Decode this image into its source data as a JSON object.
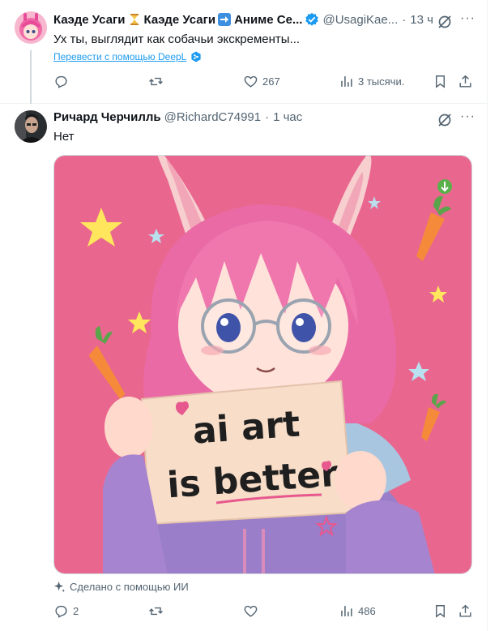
{
  "tweet1": {
    "display_name_part1": "Каэде Усаги",
    "display_name_part2": "Каэде Усаги",
    "display_name_part3": "Аниме Се...",
    "handle": "@UsagiKae...",
    "time": "13 ч",
    "text": "Ух ты, выглядит как собачьи экскременты...",
    "translate_link": "Перевести с помощью DeepL",
    "actions": {
      "reply": "",
      "retweet": "",
      "like": "267",
      "views": "3 тысячи."
    },
    "icons": {
      "emoji1": "hourglass-icon",
      "emoji2": "right-arrow-icon",
      "verified": "verified-badge-icon"
    }
  },
  "tweet2": {
    "display_name": "Ричард Черчилль",
    "handle": "@RichardC74991",
    "time": "1 час",
    "text": "Нет",
    "image": {
      "sign_line1": "ai art",
      "sign_line2": "is better"
    },
    "made_with": "Сделано с помощью ИИ",
    "actions": {
      "reply": "2",
      "retweet": "",
      "like": "",
      "views": "486"
    }
  },
  "colors": {
    "link": "#1d9bf0",
    "secondary_text": "#536471",
    "verified_blue": "#1d9bf0",
    "image_background": "#e9678f"
  }
}
